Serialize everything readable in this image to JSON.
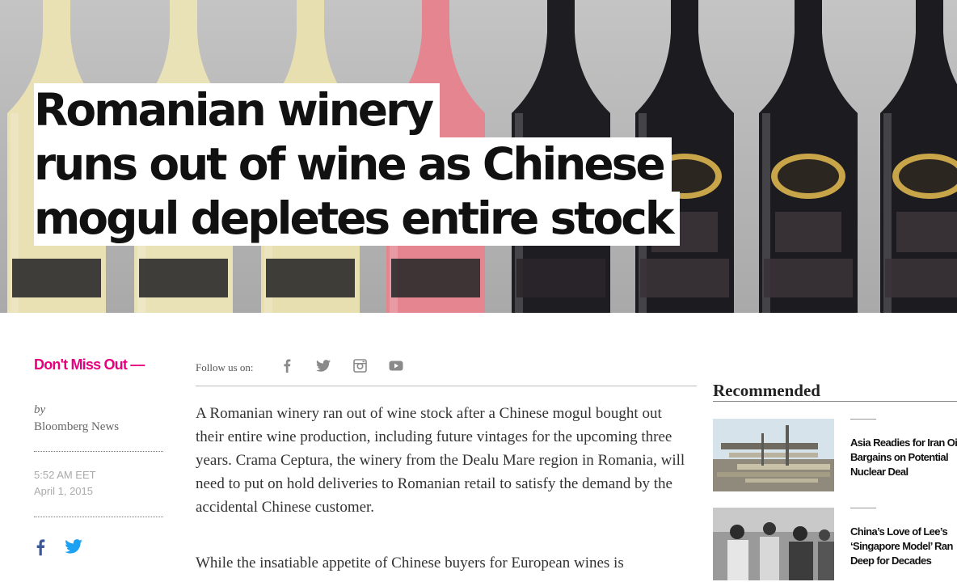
{
  "headline": {
    "lines": [
      "Romanian winery",
      "runs out of wine as Chinese",
      "mogul depletes entire stock"
    ]
  },
  "dont_miss": "Don't Miss Out —",
  "follow": {
    "label": "Follow us on:",
    "icons": [
      "facebook-icon",
      "twitter-icon",
      "instagram-icon",
      "youtube-icon"
    ]
  },
  "byline": {
    "by": "by",
    "author": "Bloomberg News"
  },
  "dateline": {
    "time": "5:52 AM EET",
    "date": "April 1, 2015"
  },
  "share": {
    "icons": [
      "facebook-icon",
      "twitter-icon"
    ]
  },
  "article": {
    "paragraphs": [
      "A Romanian winery ran out of wine stock after a Chinese mogul bought out their entire wine production, including future vintages for the upcoming three years. Crama Ceptura, the winery from the Dealu Mare region in Romania, will need to put on hold deliveries to Romanian retail to satisfy the demand by the accidental Chinese customer.",
      "While the insatiable appetite of Chinese buyers for European wines is"
    ]
  },
  "recommended": {
    "title": "Recommended",
    "items": [
      {
        "lines": [
          "Asia Readies for Iran Oil",
          "Bargains on Potential",
          "Nuclear Deal"
        ]
      },
      {
        "lines": [
          "China’s Love of Lee’s",
          "‘Singapore Model’ Ran",
          "Deep for Decades"
        ]
      }
    ]
  },
  "colors": {
    "accent": "#e6007e",
    "facebook": "#3b5998",
    "twitter": "#1da1f2"
  }
}
